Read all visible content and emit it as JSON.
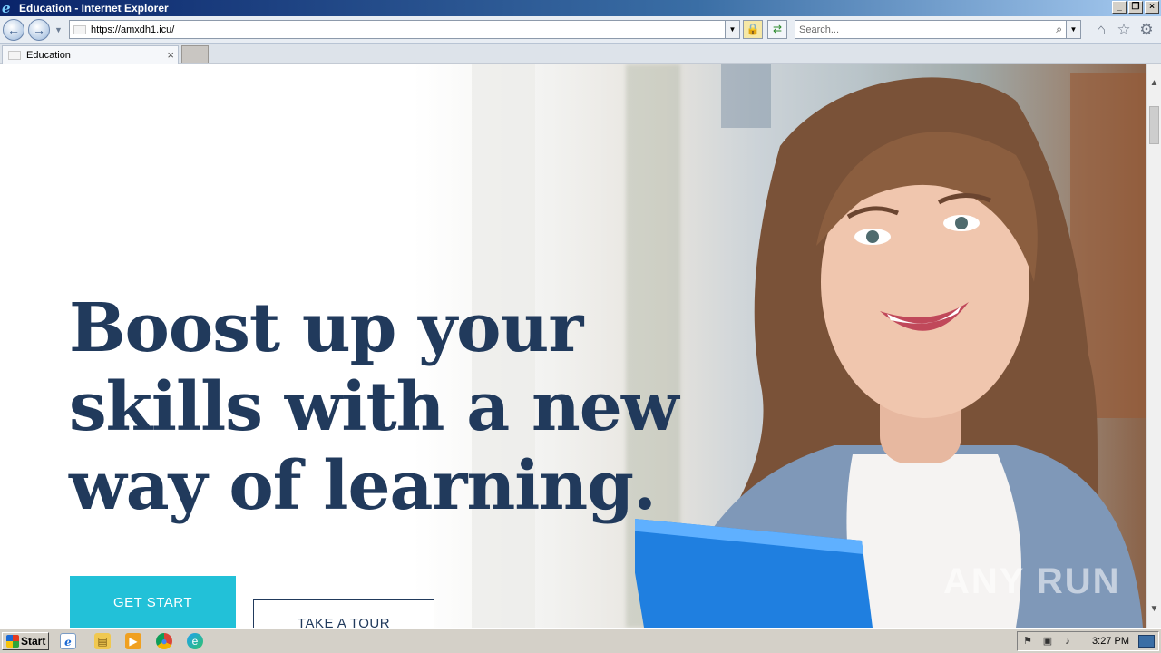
{
  "window": {
    "title": "Education - Internet Explorer",
    "buttons": [
      "minimize",
      "restore",
      "close"
    ]
  },
  "navbar": {
    "url": "https://amxdh1.icu/",
    "search_placeholder": "Search...",
    "icons": [
      "back-icon",
      "forward-icon",
      "lock-icon",
      "refresh-icon",
      "home-icon",
      "favorites-star-icon",
      "settings-gear-icon"
    ]
  },
  "tabs": [
    {
      "label": "Education"
    }
  ],
  "hero": {
    "title": "Boost up your skills with a new way of learning.",
    "primary_button": "GET START",
    "secondary_button": "TAKE A TOUR"
  },
  "watermark": "ANY RUN",
  "taskbar": {
    "start_label": "Start",
    "clock": "3:27 PM",
    "quick_launch": [
      "internet-explorer-icon",
      "folder-icon",
      "media-player-icon",
      "chrome-icon",
      "edge-icon"
    ]
  },
  "colors": {
    "heading": "#213a5c",
    "accent": "#22c1d8",
    "titlebar": "#0a246a"
  }
}
